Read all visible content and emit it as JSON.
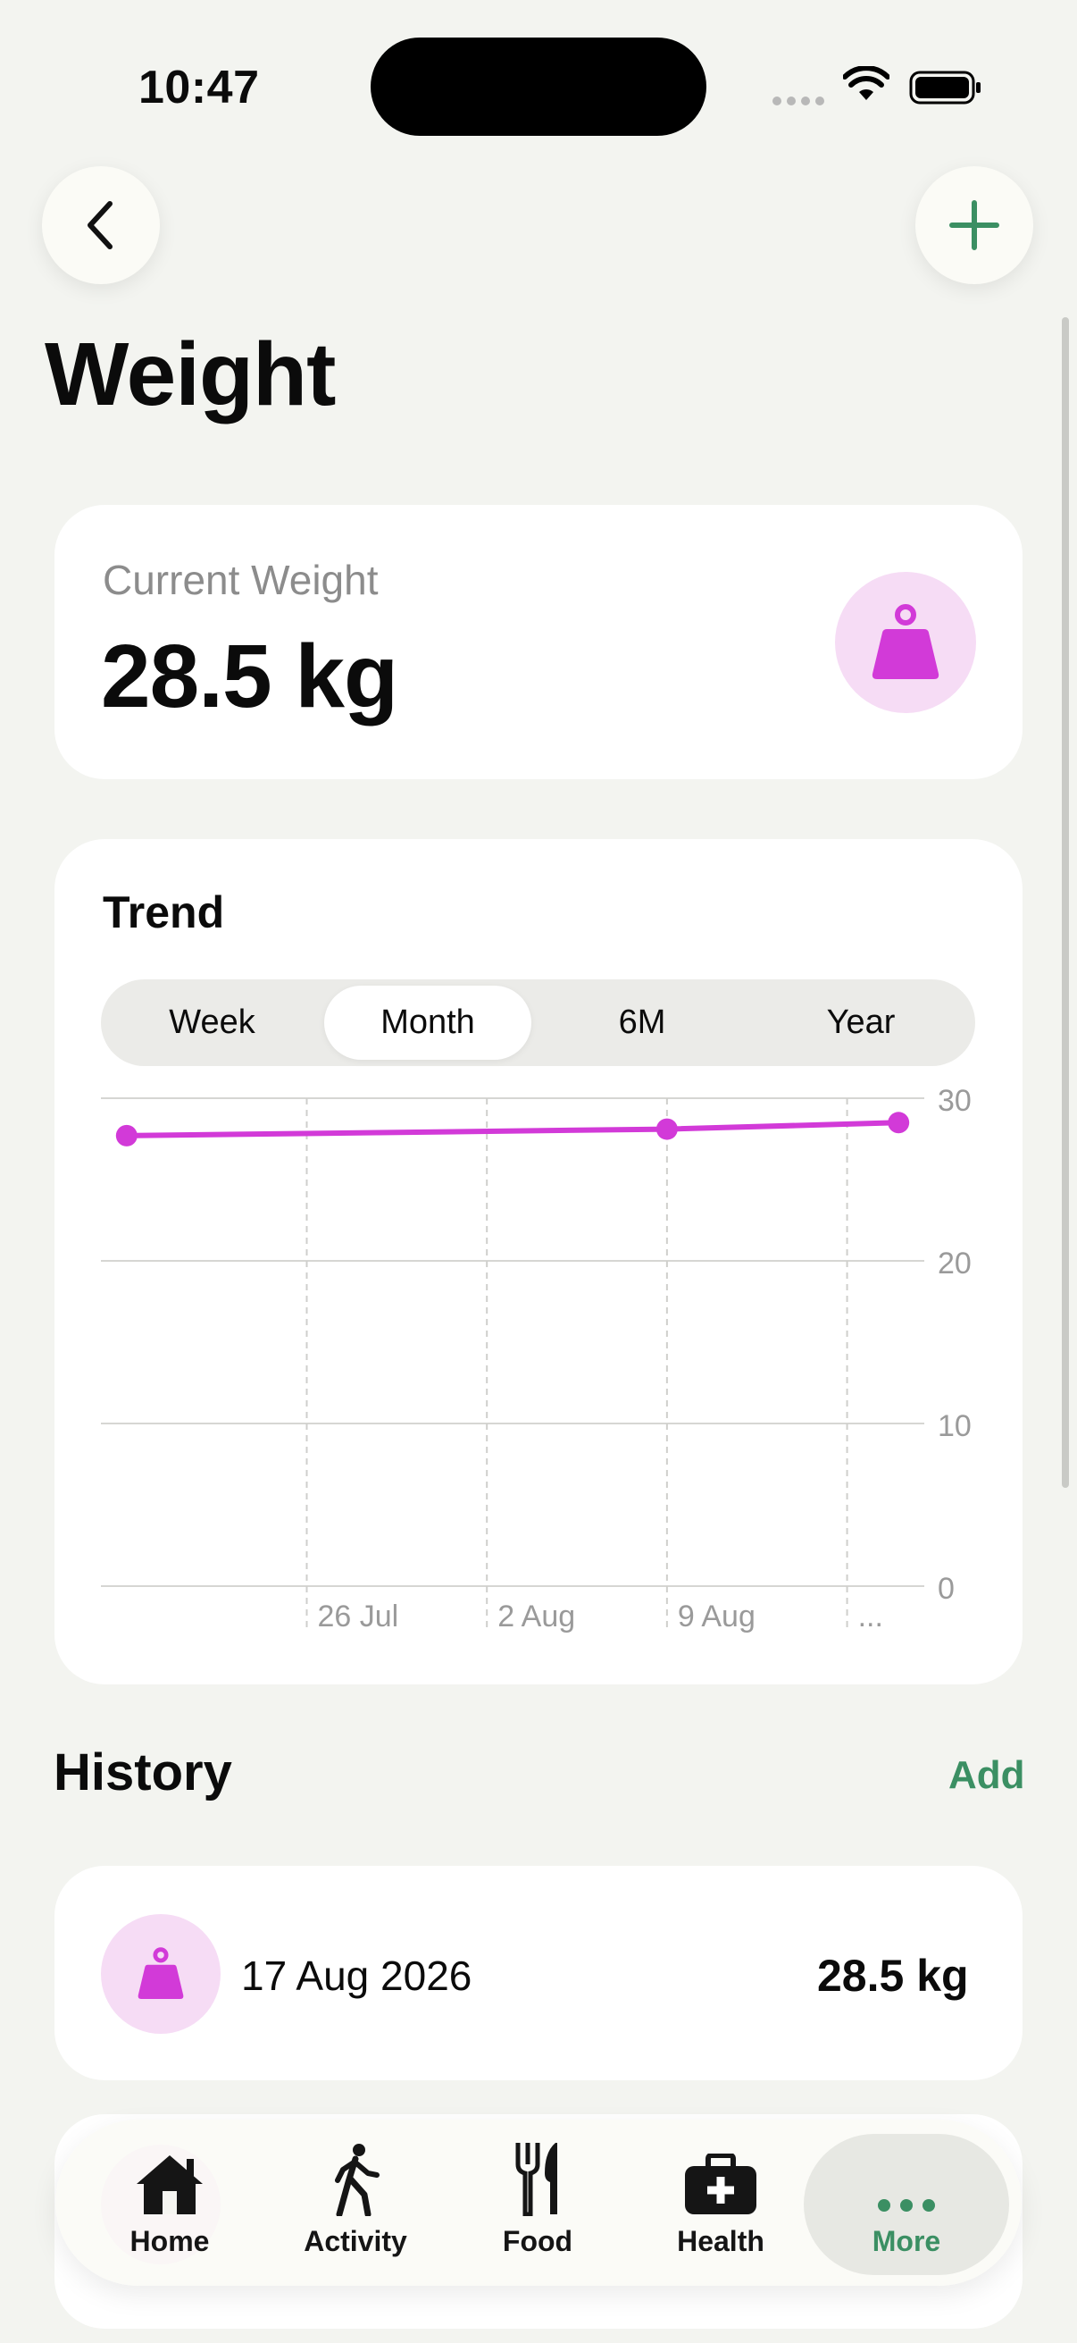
{
  "status_bar": {
    "time": "10:47"
  },
  "header": {
    "title": "Weight"
  },
  "current_weight": {
    "label": "Current Weight",
    "value": "28.5 kg"
  },
  "trend": {
    "title": "Trend",
    "ranges": [
      "Week",
      "Month",
      "6M",
      "Year"
    ],
    "selected_range": "Month"
  },
  "chart_data": {
    "type": "line",
    "x_tick_labels": [
      "26 Jul",
      "2 Aug",
      "9 Aug",
      "..."
    ],
    "y_tick_labels": [
      "30",
      "20",
      "10",
      "0"
    ],
    "ylim": [
      0,
      30
    ],
    "series": [
      {
        "points": [
          {
            "x": "18 Jul 2026",
            "y": 27.7
          },
          {
            "x": "8 Aug 2026",
            "y": 28.1
          },
          {
            "x": "17 Aug 2026",
            "y": 28.5
          }
        ]
      }
    ],
    "series_color": "#d23ad8",
    "grid": true
  },
  "history": {
    "title": "History",
    "add_label": "Add",
    "entries": [
      {
        "date": "17 Aug 2026",
        "value": "28.5 kg"
      }
    ]
  },
  "tab_bar": {
    "items": [
      {
        "label": "Home",
        "icon": "house-icon"
      },
      {
        "label": "Activity",
        "icon": "walking-figure-icon"
      },
      {
        "label": "Food",
        "icon": "fork-knife-icon"
      },
      {
        "label": "Health",
        "icon": "medical-kit-icon"
      },
      {
        "label": "More",
        "icon": "ellipsis-icon",
        "selected": true
      }
    ]
  },
  "colors": {
    "accent_green": "#3b8f63",
    "weight_magenta": "#d23ad8",
    "weight_icon_bg": "#f6dcf5",
    "background": "#f3f4f0"
  }
}
